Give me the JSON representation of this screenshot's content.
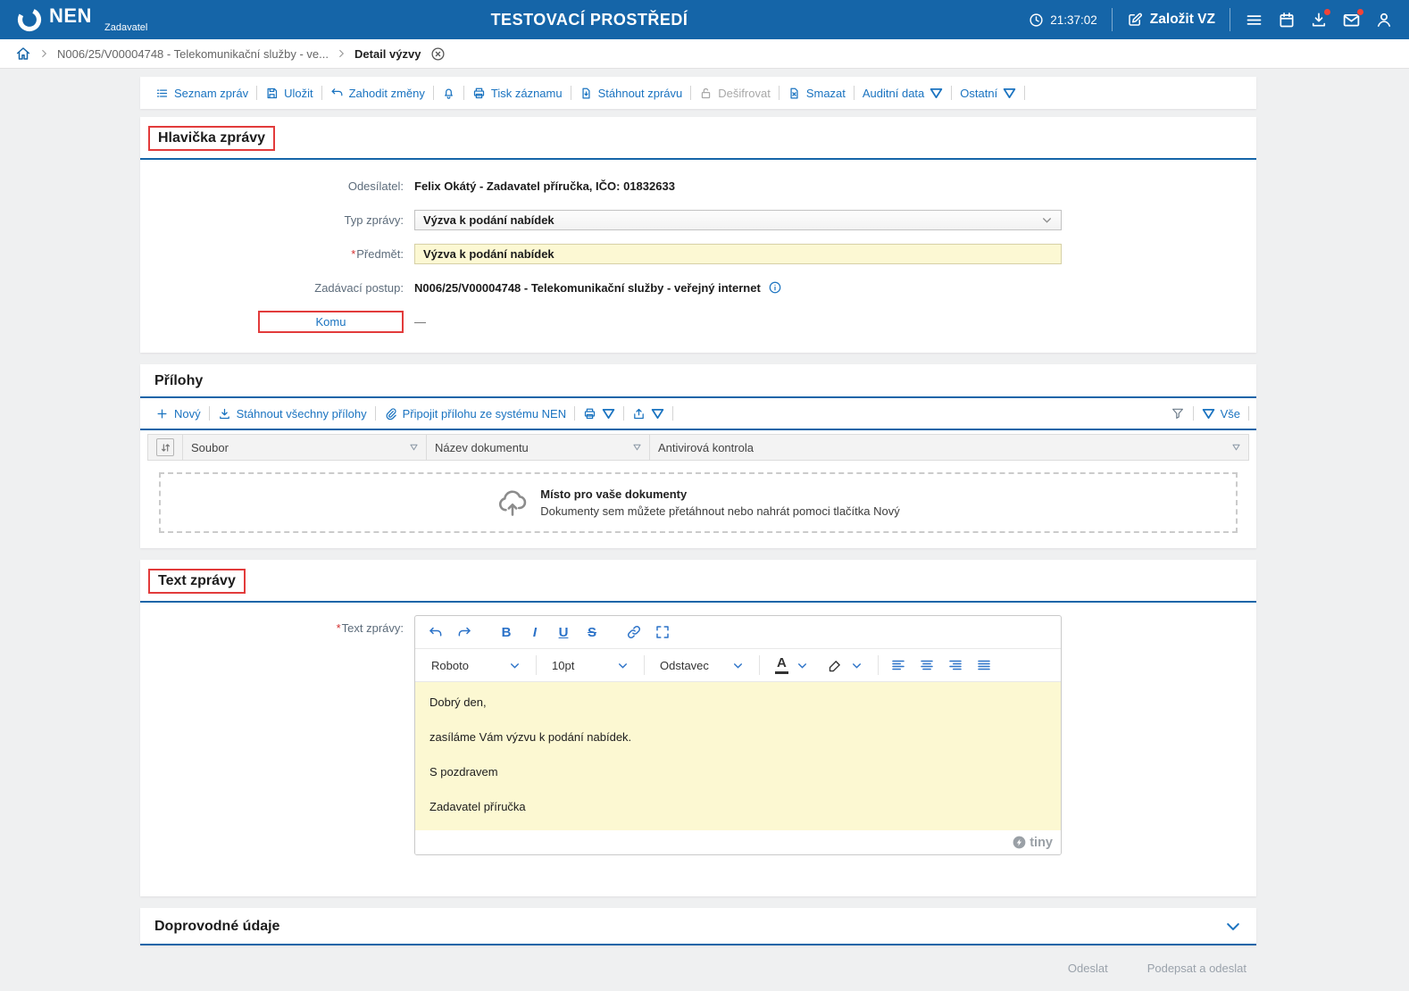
{
  "colors": {
    "header_bg": "#1565a8",
    "link_blue": "#1a73c0",
    "section_rule": "#1565a8",
    "annotation_red": "#e23b3b",
    "badge_red": "#f44336",
    "input_highlight_yellow": "#fcf8d3",
    "editor_text_bg": "#fcf8d2"
  },
  "icons": {
    "clock-icon": "circle+hands",
    "edit-icon": "pencil-square",
    "hamburger-icon": "three-bars",
    "calendar-icon": "calendar",
    "download-icon": "arrow-into-tray",
    "mail-icon": "envelope",
    "user-icon": "person",
    "home-icon": "house",
    "close-icon": "circled-x",
    "list-icon": "list-lines",
    "save-icon": "floppy",
    "undo-icon": "curved-arrow-left",
    "bell-icon": "bell",
    "print-icon": "printer",
    "doc-download-icon": "document-arrow",
    "unlock-icon": "open-padlock",
    "doc-delete-icon": "document-x",
    "plus-icon": "+",
    "paperclip-icon": "paperclip",
    "share-icon": "arrow-up-tray",
    "funnel-icon": "funnel",
    "sort-icon": "up-down-arrows",
    "cloud-upload-icon": "cloud-arrow-up",
    "info-icon": "circled-i",
    "link-icon": "chain",
    "fullscreen-icon": "corner-arrows",
    "chevron-down-icon": "v",
    "filter-triangle-icon": "outlined-down-triangle"
  },
  "header": {
    "brand": "NEN",
    "brand_sub": "Zadavatel",
    "env_title": "TESTOVACÍ PROSTŘEDÍ",
    "time": "21:37:02",
    "create_vz_label": "Založit VZ"
  },
  "breadcrumb": {
    "procedure": "N006/25/V00004748 - Telekomunikační služby - ve...",
    "current": "Detail výzvy"
  },
  "toolbar": {
    "seznam_zprav": "Seznam zpráv",
    "ulozit": "Uložit",
    "zahodit_zmeny": "Zahodit změny",
    "tisk_zaznamu": "Tisk záznamu",
    "stahnout_zpravu": "Stáhnout zprávu",
    "desifrovat": "Dešifrovat",
    "smazat": "Smazat",
    "auditni_data": "Auditní data",
    "ostatni": "Ostatní"
  },
  "message_header": {
    "title": "Hlavička zprávy",
    "fields": {
      "sender_label": "Odesílatel:",
      "sender_value": "Felix Okátý - Zadavatel příručka, IČO: 01832633",
      "type_label": "Typ zprávy:",
      "type_value": "Výzva k podání nabídek",
      "subject_required": "*",
      "subject_label": "Předmět:",
      "subject_value": "Výzva k podání nabídek",
      "procedure_label": "Zadávací postup:",
      "procedure_value": "N006/25/V00004748 - Telekomunikační služby - veřejný internet",
      "to_label": "Komu",
      "to_value": "—"
    }
  },
  "attachments": {
    "title": "Přílohy",
    "toolbar": {
      "novy": "Nový",
      "stahnout_vse": "Stáhnout všechny přílohy",
      "pripojit": "Připojit přílohu ze systému NEN",
      "vse": "Vše"
    },
    "columns": [
      "Soubor",
      "Název dokumentu",
      "Antivirová kontrola"
    ],
    "dropzone": {
      "title": "Místo pro vaše dokumenty",
      "subtitle": "Dokumenty sem můžete přetáhnout nebo nahrát pomoci tlačítka Nový"
    }
  },
  "message_body": {
    "title": "Text zprávy",
    "required": "*",
    "label": "Text zprávy:",
    "editor": {
      "font_name": "Roboto",
      "font_size": "10pt",
      "block_format": "Odstavec",
      "buttons": {
        "bold": "B",
        "italic": "I",
        "underline": "U",
        "strikethrough": "S",
        "text_color": "A"
      },
      "paragraphs": [
        "Dobrý den,",
        "zasíláme Vám výzvu k podání nabídek.",
        "S pozdravem",
        "Zadavatel příručka"
      ],
      "brand": "tiny"
    }
  },
  "additional_section": {
    "title": "Doprovodné údaje"
  },
  "footer": {
    "odeslat": "Odeslat",
    "podepsat": "Podepsat a odeslat"
  }
}
